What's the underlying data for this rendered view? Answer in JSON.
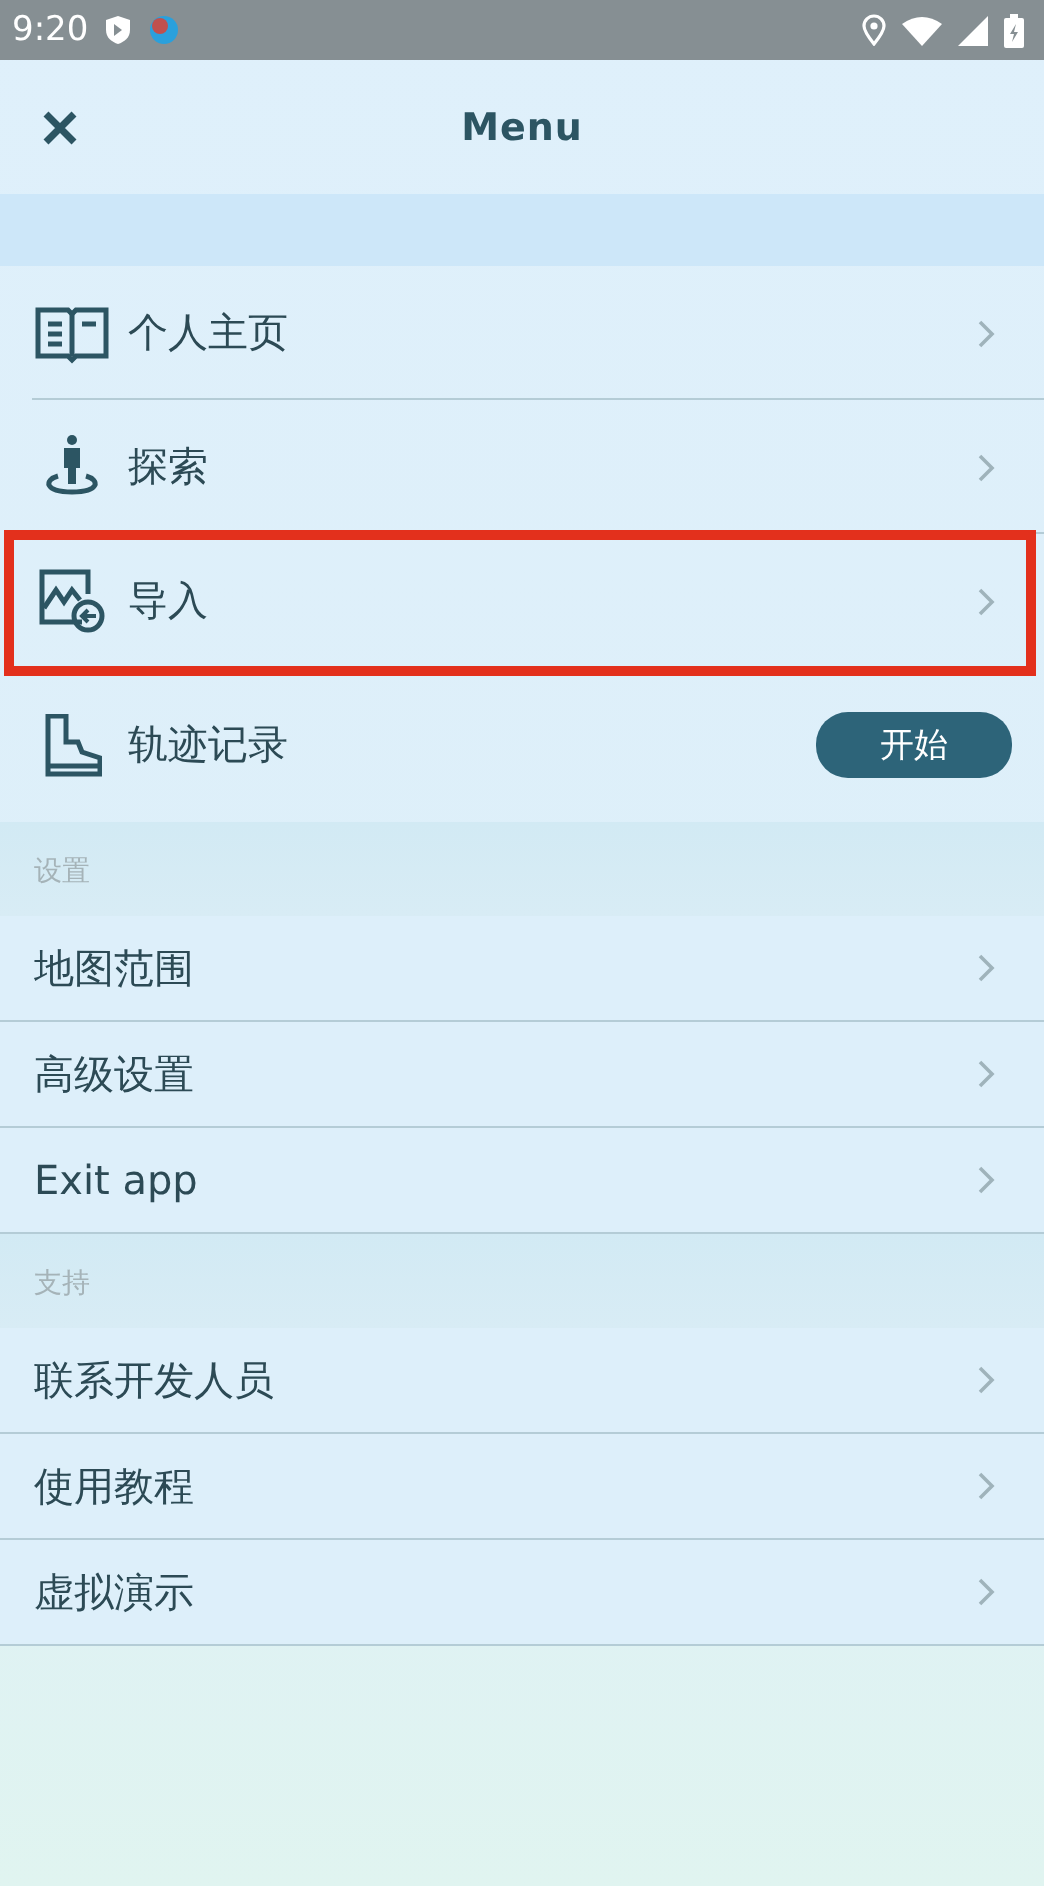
{
  "status_bar": {
    "time": "9:20"
  },
  "header": {
    "title": "Menu"
  },
  "main_items": [
    {
      "kind": "link",
      "label": "个人主页",
      "highlighted": false
    },
    {
      "kind": "link",
      "label": "探索",
      "highlighted": false
    },
    {
      "kind": "link",
      "label": "导入",
      "highlighted": true
    },
    {
      "kind": "action",
      "label": "轨迹记录",
      "button": "开始",
      "highlighted": false
    }
  ],
  "sections": [
    {
      "title": "设置",
      "items": [
        {
          "label": "地图范围"
        },
        {
          "label": "高级设置"
        },
        {
          "label": "Exit app"
        }
      ]
    },
    {
      "title": "支持",
      "items": [
        {
          "label": "联系开发人员"
        },
        {
          "label": "使用教程"
        },
        {
          "label": "虚拟演示"
        }
      ]
    }
  ]
}
